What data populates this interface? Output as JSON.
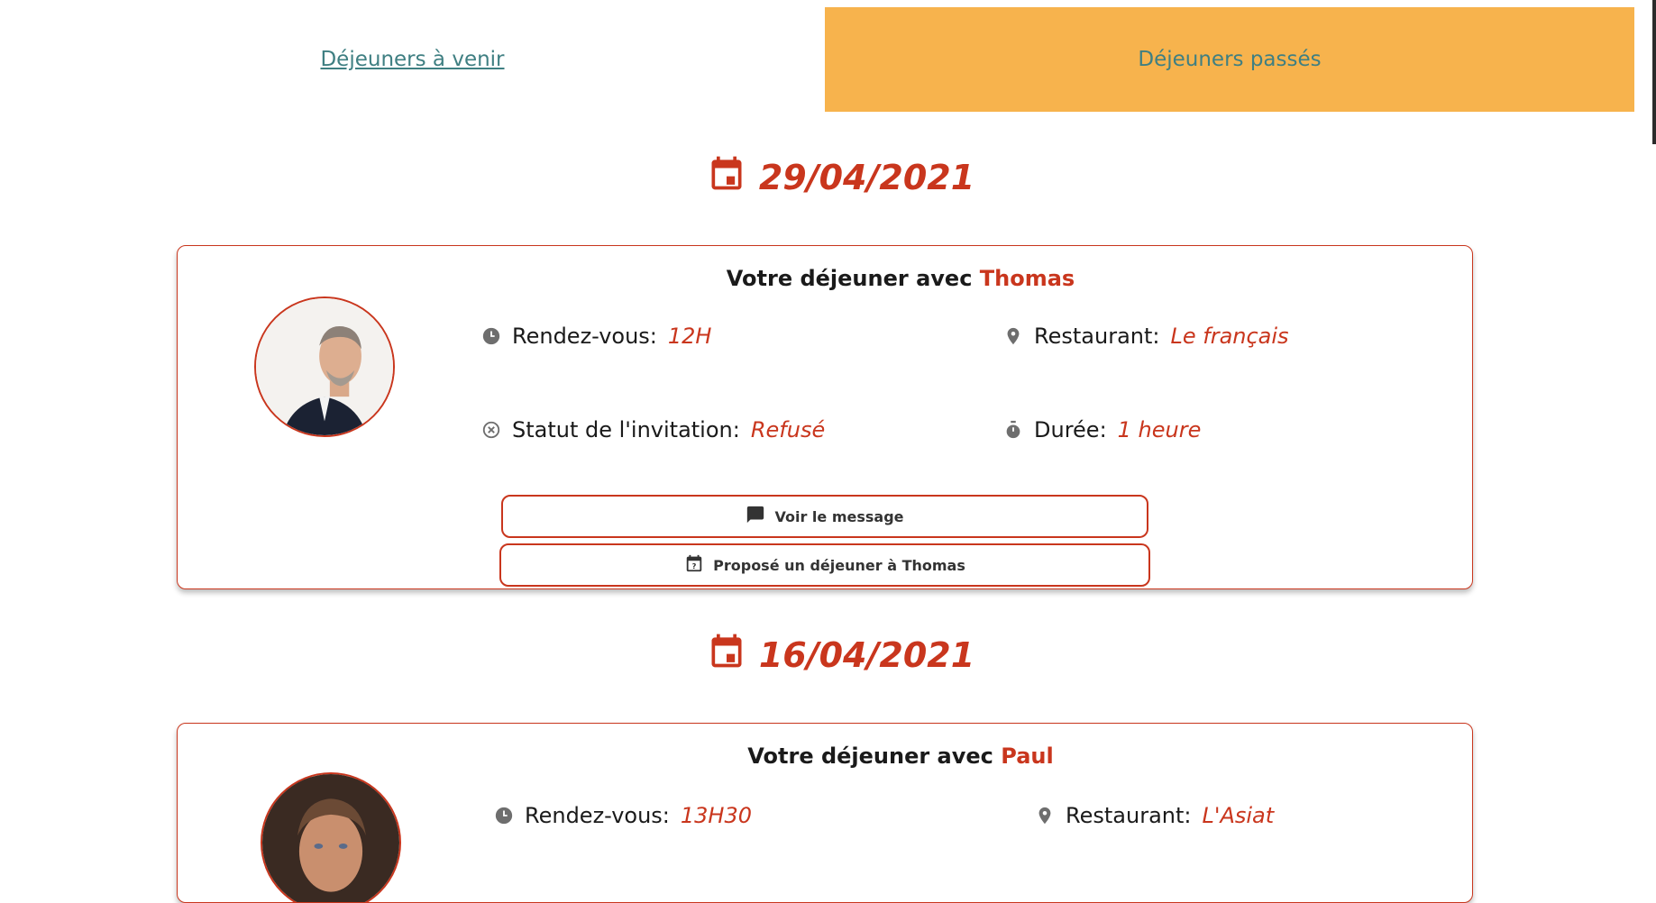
{
  "tabs": {
    "upcoming": "Déjeuners à venir",
    "past": "Déjeuners passés"
  },
  "colors": {
    "accent": "#c9361d",
    "tab_active_bg": "#f7b34d",
    "tab_text": "#3f7f82"
  },
  "icons": {
    "date": "calendar-icon",
    "time": "clock-icon",
    "restaurant": "location-pin-icon",
    "status": "cancel-circle-icon",
    "duration": "stopwatch-icon",
    "message": "chat-bubble-icon",
    "propose": "calendar-question-icon"
  },
  "lunches": [
    {
      "date": "29/04/2021",
      "title_prefix": "Votre déjeuner avec",
      "person": "Thomas",
      "rendezvous_label": "Rendez-vous:",
      "rendezvous_value": "12H",
      "restaurant_label": "Restaurant:",
      "restaurant_value": "Le français",
      "status_label": "Statut de l'invitation:",
      "status_value": "Refusé",
      "duration_label": "Durée:",
      "duration_value": "1 heure",
      "message_button": "Voir le message",
      "propose_button": "Proposé un déjeuner à Thomas"
    },
    {
      "date": "16/04/2021",
      "title_prefix": "Votre déjeuner avec",
      "person": "Paul",
      "rendezvous_label": "Rendez-vous:",
      "rendezvous_value": "13H30",
      "restaurant_label": "Restaurant:",
      "restaurant_value": "L'Asiat"
    }
  ]
}
